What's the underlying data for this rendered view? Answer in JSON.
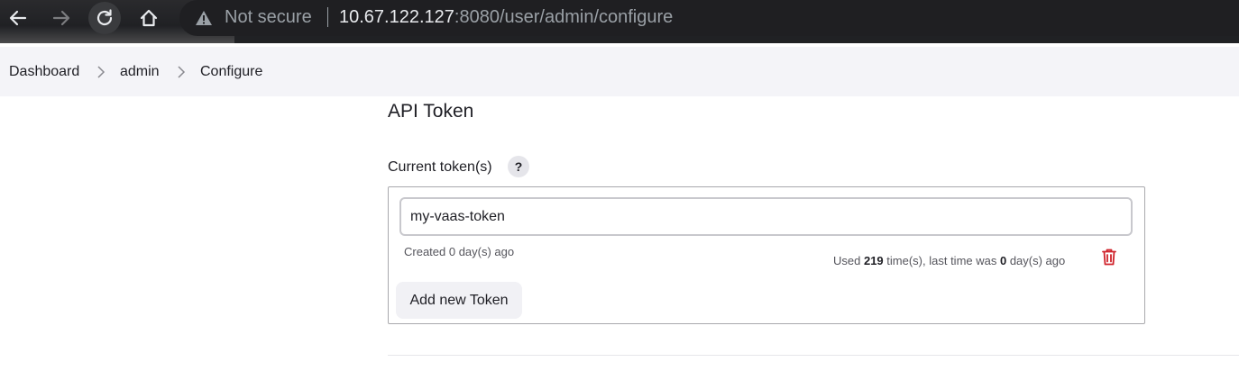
{
  "browser": {
    "security_label": "Not secure",
    "url_host": "10.67.122.127",
    "url_path": ":8080/user/admin/configure",
    "icons": [
      "back-arrow-icon",
      "forward-arrow-icon",
      "reload-icon",
      "home-icon",
      "warning-icon"
    ]
  },
  "breadcrumb": {
    "items": [
      "Dashboard",
      "admin",
      "Configure"
    ]
  },
  "section": {
    "title": "API Token",
    "field_label": "Current token(s)",
    "help_label": "?"
  },
  "token": {
    "name": "my-vaas-token",
    "created": "Created 0 day(s) ago",
    "usage_prefix": "Used ",
    "usage_count": "219",
    "usage_mid": " time(s), last time was ",
    "usage_days": "0",
    "usage_suffix": " day(s) ago"
  },
  "actions": {
    "add_token": "Add new Token"
  },
  "colors": {
    "delete": "#d0242c",
    "chrome_bg": "#202124"
  }
}
